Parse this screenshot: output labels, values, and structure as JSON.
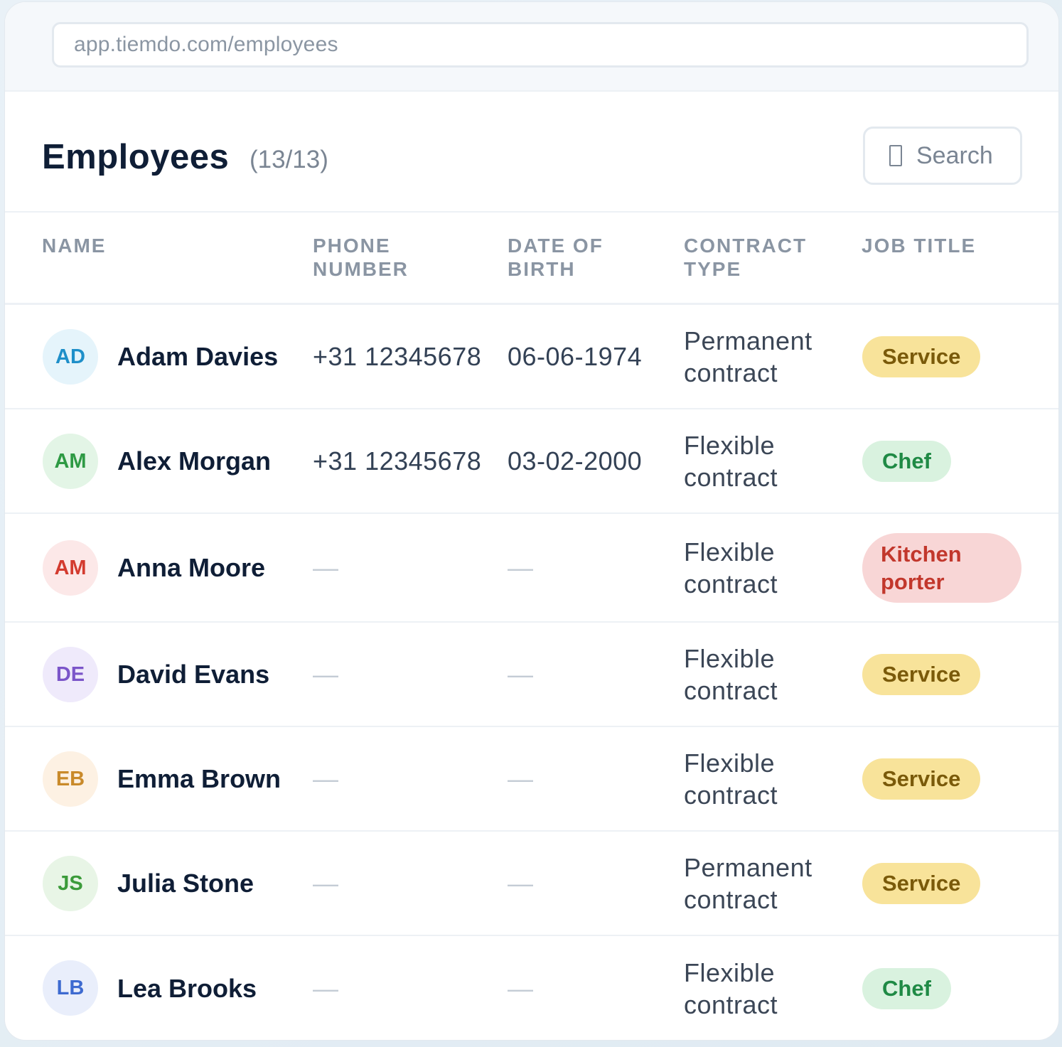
{
  "browser": {
    "url": "app.tiemdo.com/employees"
  },
  "header": {
    "title": "Employees",
    "count": "(13/13)",
    "search_label": "Search",
    "search_icon": "search-icon"
  },
  "columns": [
    "NAME",
    "PHONE NUMBER",
    "DATE OF BIRTH",
    "CONTRACT TYPE",
    "JOB TITLE"
  ],
  "colors": {
    "service_bg": "#f8e39a",
    "service_fg": "#7a5a0a",
    "chef_bg": "#d9f2df",
    "chef_fg": "#1f8a45",
    "porter_bg": "#f8d6d6",
    "porter_fg": "#c2372c"
  },
  "employees": [
    {
      "initials": "AD",
      "name": "Adam Davies",
      "phone": "+31 12345678",
      "dob": "06-06-1974",
      "contract": "Permanent contract",
      "job": "Service",
      "avatar_bg": "#e5f4fb",
      "avatar_fg": "#1e8fc9"
    },
    {
      "initials": "AM",
      "name": "Alex Morgan",
      "phone": "+31 12345678",
      "dob": "03-02-2000",
      "contract": "Flexible contract",
      "job": "Chef",
      "avatar_bg": "#e3f5e6",
      "avatar_fg": "#2e9a44"
    },
    {
      "initials": "AM",
      "name": "Anna Moore",
      "phone": "—",
      "dob": "—",
      "contract": "Flexible contract",
      "job": "Kitchen porter",
      "avatar_bg": "#fce8e8",
      "avatar_fg": "#d33b2f"
    },
    {
      "initials": "DE",
      "name": "David Evans",
      "phone": "—",
      "dob": "—",
      "contract": "Flexible contract",
      "job": "Service",
      "avatar_bg": "#efeafb",
      "avatar_fg": "#7b55c9"
    },
    {
      "initials": "EB",
      "name": "Emma Brown",
      "phone": "—",
      "dob": "—",
      "contract": "Flexible contract",
      "job": "Service",
      "avatar_bg": "#fdf1e3",
      "avatar_fg": "#c98a2a"
    },
    {
      "initials": "JS",
      "name": "Julia Stone",
      "phone": "—",
      "dob": "—",
      "contract": "Permanent contract",
      "job": "Service",
      "avatar_bg": "#e8f5e6",
      "avatar_fg": "#3b9b3a"
    },
    {
      "initials": "LB",
      "name": "Lea Brooks",
      "phone": "—",
      "dob": "—",
      "contract": "Flexible contract",
      "job": "Chef",
      "avatar_bg": "#e9eefb",
      "avatar_fg": "#3d6ad0"
    }
  ]
}
